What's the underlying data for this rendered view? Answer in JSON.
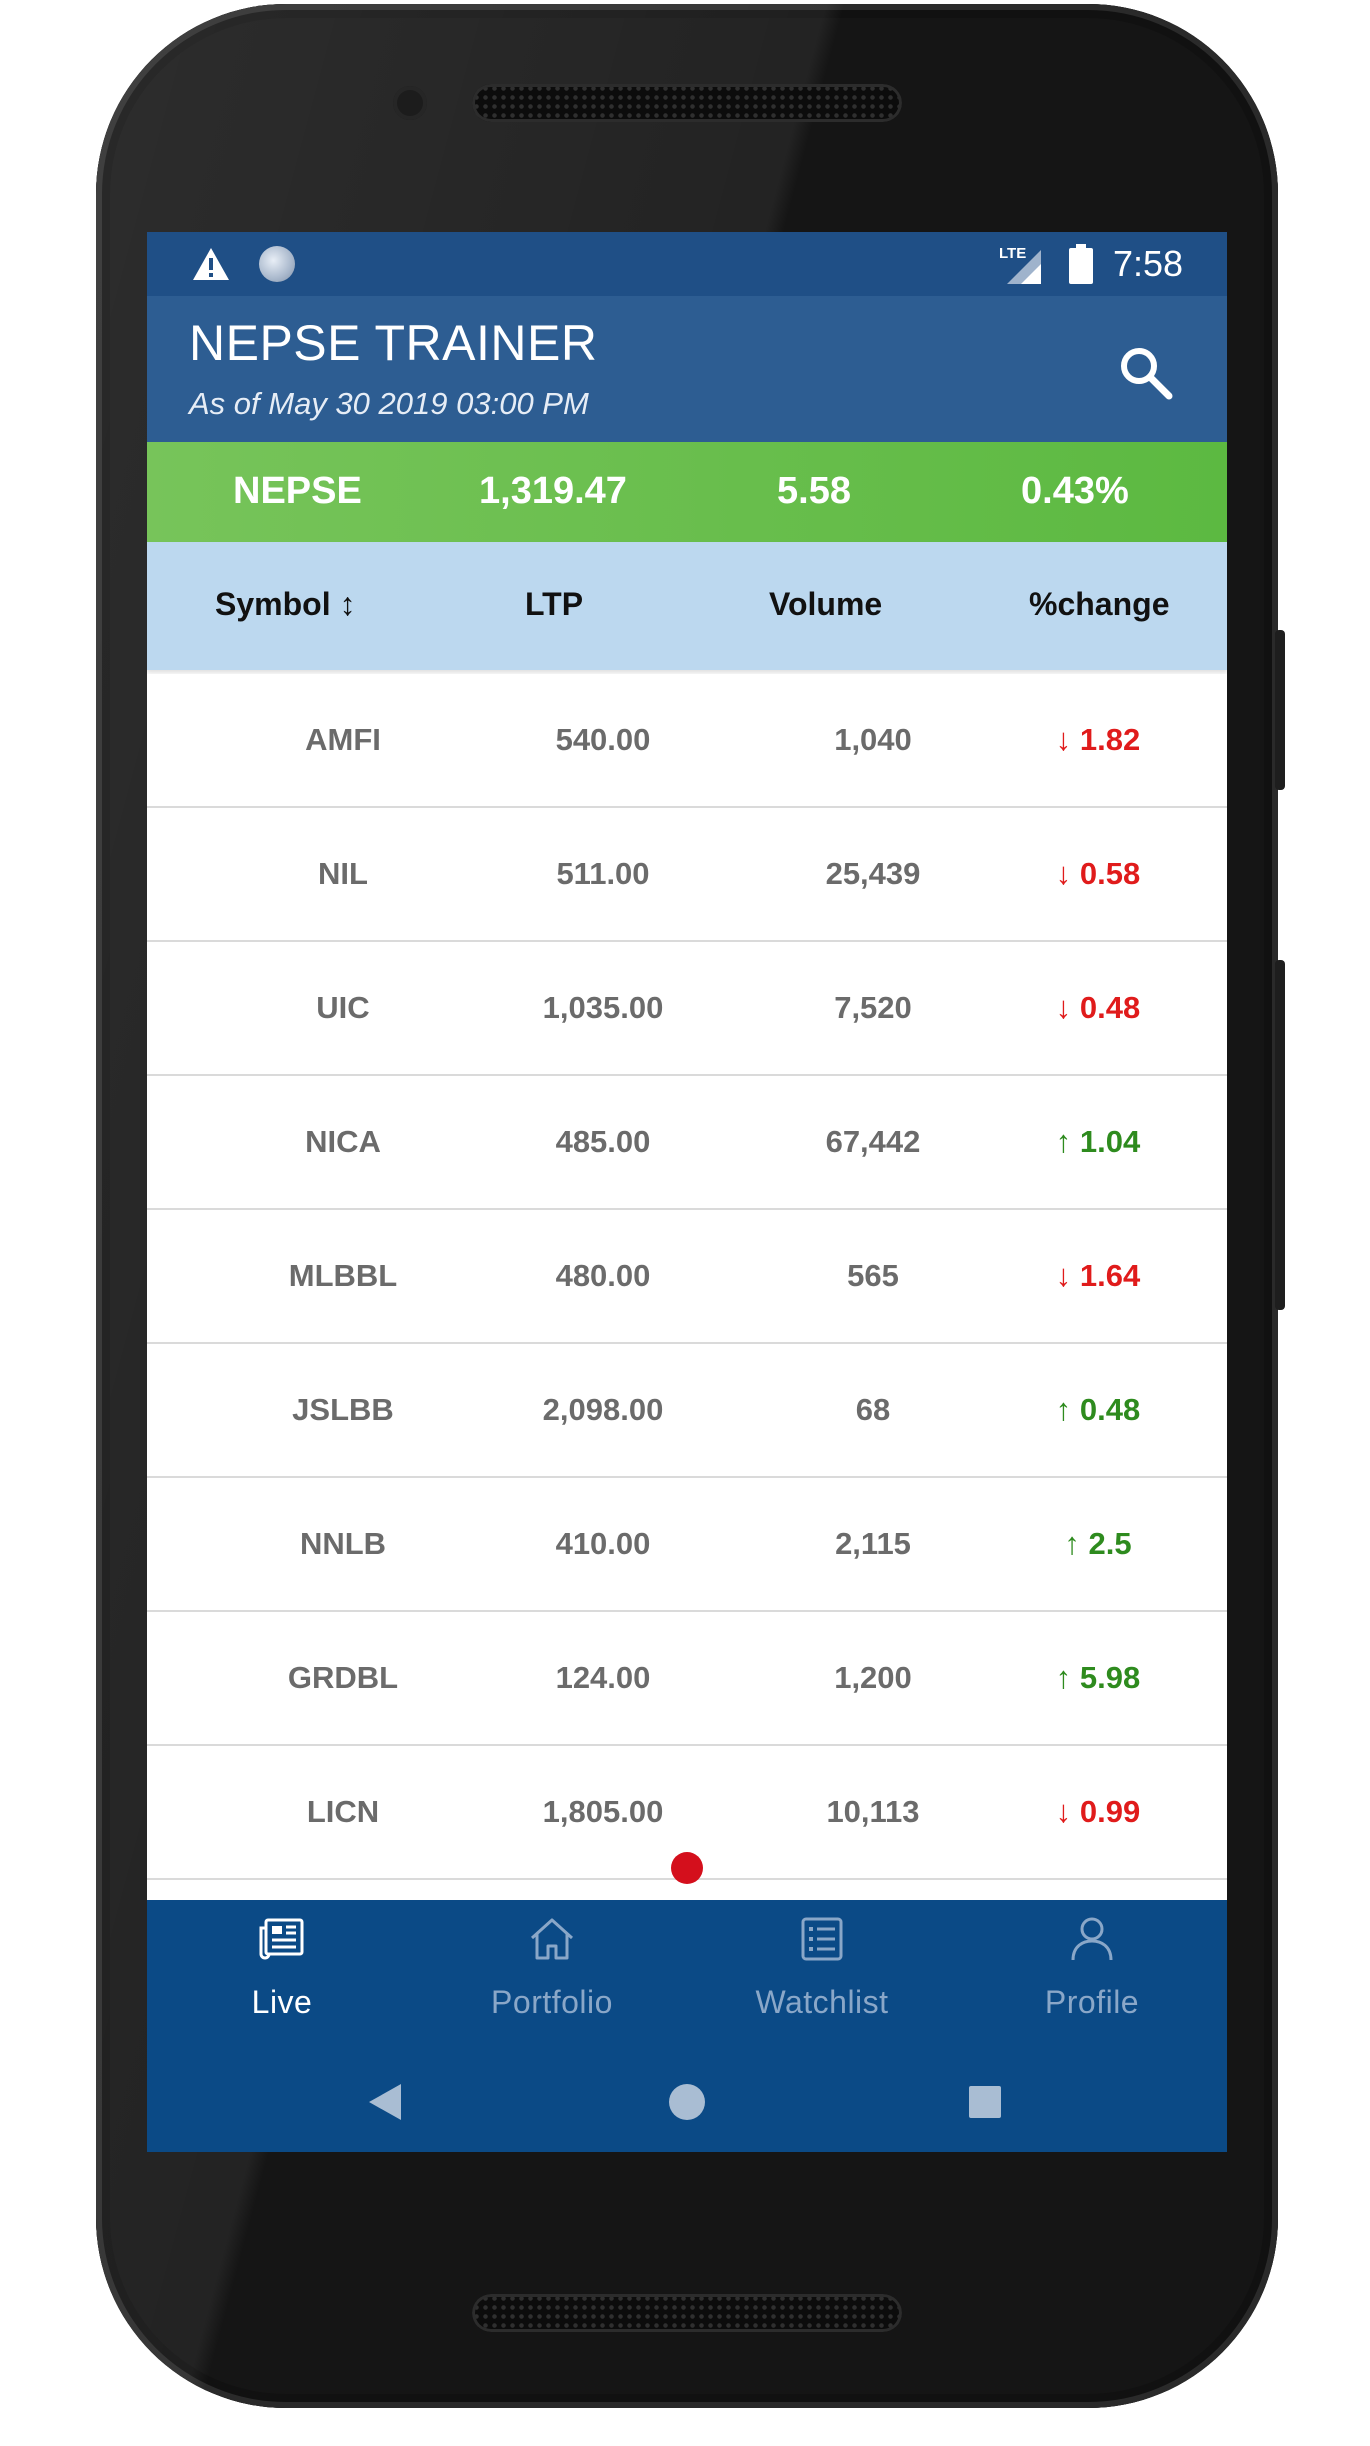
{
  "status_bar": {
    "network": "LTE",
    "time": "7:58"
  },
  "app_bar": {
    "title": "NEPSE TRAINER",
    "subtitle": "As of May 30 2019 03:00 PM",
    "search_icon": "search-icon"
  },
  "index": {
    "name": "NEPSE",
    "value": "1,319.47",
    "change": "5.58",
    "percent": "0.43%"
  },
  "table": {
    "headers": [
      "Symbol ↕",
      "LTP",
      "Volume",
      "%change"
    ],
    "rows": [
      {
        "symbol": "AMFI",
        "ltp": "540.00",
        "volume": "1,040",
        "change": "↓ 1.82",
        "direction": "down"
      },
      {
        "symbol": "NIL",
        "ltp": "511.00",
        "volume": "25,439",
        "change": "↓ 0.58",
        "direction": "down"
      },
      {
        "symbol": "UIC",
        "ltp": "1,035.00",
        "volume": "7,520",
        "change": "↓ 0.48",
        "direction": "down"
      },
      {
        "symbol": "NICA",
        "ltp": "485.00",
        "volume": "67,442",
        "change": "↑ 1.04",
        "direction": "up"
      },
      {
        "symbol": "MLBBL",
        "ltp": "480.00",
        "volume": "565",
        "change": "↓ 1.64",
        "direction": "down"
      },
      {
        "symbol": "JSLBB",
        "ltp": "2,098.00",
        "volume": "68",
        "change": "↑ 0.48",
        "direction": "up"
      },
      {
        "symbol": "NNLB",
        "ltp": "410.00",
        "volume": "2,115",
        "change": "↑ 2.5",
        "direction": "up"
      },
      {
        "symbol": "GRDBL",
        "ltp": "124.00",
        "volume": "1,200",
        "change": "↑ 5.98",
        "direction": "up"
      },
      {
        "symbol": "LICN",
        "ltp": "1,805.00",
        "volume": "10,113",
        "change": "↓ 0.99",
        "direction": "down"
      }
    ]
  },
  "bottom_nav": {
    "items": [
      {
        "label": "Live",
        "icon": "newspaper-icon",
        "active": true
      },
      {
        "label": "Portfolio",
        "icon": "home-icon",
        "active": false
      },
      {
        "label": "Watchlist",
        "icon": "list-icon",
        "active": false
      },
      {
        "label": "Profile",
        "icon": "person-icon",
        "active": false
      }
    ]
  },
  "colors": {
    "status_bar": "#1f4f86",
    "app_bar": "#2d5d92",
    "index_bar": "#5cb941",
    "table_header": "#bcd8ef",
    "bottom_nav": "#0b4a86",
    "up": "#2e8b1e",
    "down": "#e01b1b"
  }
}
